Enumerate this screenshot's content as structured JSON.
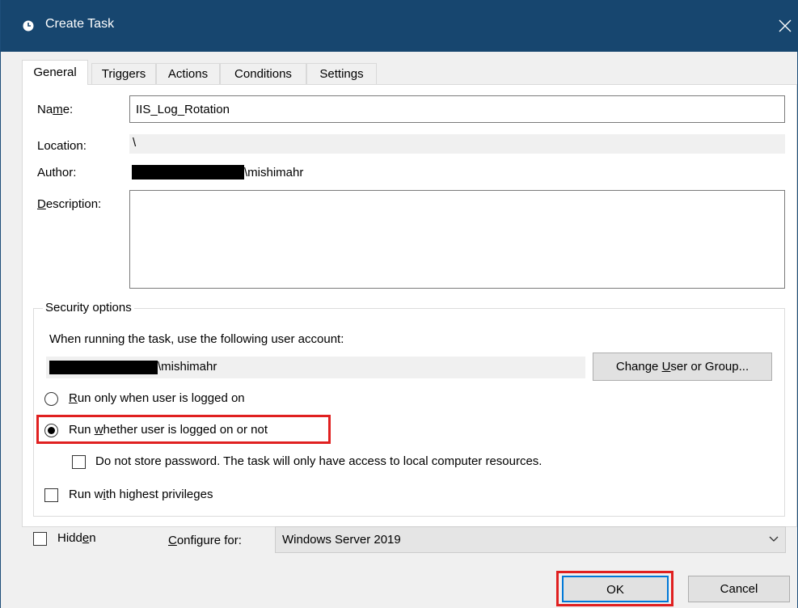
{
  "window": {
    "title": "Create Task",
    "icon": "clock-icon",
    "close_glyph": "✕"
  },
  "tabs": [
    {
      "label": "General",
      "active": true
    },
    {
      "label": "Triggers",
      "active": false
    },
    {
      "label": "Actions",
      "active": false
    },
    {
      "label": "Conditions",
      "active": false
    },
    {
      "label": "Settings",
      "active": false
    }
  ],
  "general": {
    "name": {
      "label_pre": "Na",
      "label_u": "m",
      "label_post": "e:",
      "value": "IIS_Log_Rotation"
    },
    "location": {
      "label": "Location:",
      "value": "\\"
    },
    "author": {
      "label": "Author:",
      "value_suffix": "\\mishimahr"
    },
    "description": {
      "label_u": "D",
      "label_post": "escription:",
      "value": ""
    }
  },
  "security": {
    "title": "Security options",
    "account_prompt": "When running the task, use the following user account:",
    "account_suffix": "\\mishimahr",
    "change_button": {
      "pre": "Change ",
      "u": "U",
      "post": "ser or Group..."
    },
    "radio_logged_on": {
      "u": "R",
      "post": "un only when user is logged on",
      "selected": false
    },
    "radio_whether": {
      "pre": "Run ",
      "u": "w",
      "post": "hether user is logged on or not",
      "selected": true
    },
    "no_store_password": {
      "label": "Do not store password.  The task will only have access to local computer resources.",
      "checked": false
    },
    "highest_privileges": {
      "pre": "Run w",
      "u": "i",
      "post": "th highest privileges",
      "checked": false
    }
  },
  "footer": {
    "hidden": {
      "pre": "Hidd",
      "u": "e",
      "post": "n",
      "checked": false
    },
    "configure_for": {
      "u": "C",
      "post": "onfigure for:",
      "value": "Windows Server 2019"
    },
    "ok_label": "OK",
    "cancel_label": "Cancel"
  },
  "colors": {
    "titlebar": "#17466f",
    "highlight": "#e02020",
    "ok_focus": "#0078d7"
  }
}
